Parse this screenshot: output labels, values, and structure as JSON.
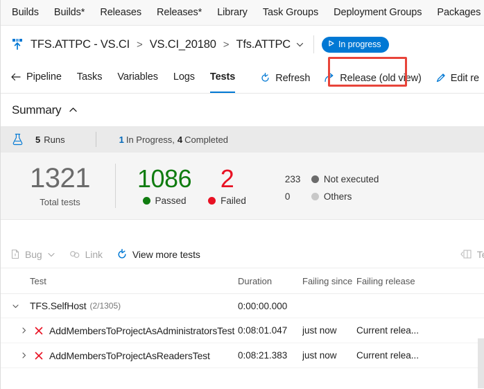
{
  "hub_nav": {
    "items": [
      {
        "label": "Builds"
      },
      {
        "label": "Builds*"
      },
      {
        "label": "Releases"
      },
      {
        "label": "Releases*"
      },
      {
        "label": "Library"
      },
      {
        "label": "Task Groups"
      },
      {
        "label": "Deployment Groups"
      },
      {
        "label": "Packages"
      }
    ]
  },
  "breadcrumb": {
    "icon": "release-pipeline-icon",
    "pipeline": "TFS.ATTPC - VS.CI",
    "separator": ">",
    "release": "VS.CI_20180",
    "stage": "Tfs.ATTPC",
    "stage_chevron_icon": "chevron-down-icon",
    "status": {
      "label": "In progress",
      "icon": "play-triangle-icon",
      "color": "#0078d4"
    },
    "highlight_color": "#e8443a"
  },
  "pivots": {
    "back_label": "Pipeline",
    "back_icon": "arrow-left-icon",
    "tabs": [
      {
        "label": "Tasks",
        "selected": false
      },
      {
        "label": "Variables",
        "selected": false
      },
      {
        "label": "Logs",
        "selected": false
      },
      {
        "label": "Tests",
        "selected": true
      }
    ],
    "selected_color": "#0078d4",
    "tools": [
      {
        "label": "Refresh",
        "icon": "refresh-icon"
      },
      {
        "label": "Release (old view)",
        "icon": "arrow-redo-icon"
      },
      {
        "label": "Edit re",
        "icon": "pencil-edit-icon"
      }
    ]
  },
  "summary": {
    "title": "Summary",
    "collapse_icon": "chevron-up-icon",
    "runs": {
      "flask_icon": "test-flask-icon",
      "count": "5",
      "label": "Runs",
      "in_progress_count": "1",
      "in_progress_label": "In Progress,",
      "completed_count": "4",
      "completed_label": "Completed"
    },
    "stats": {
      "total": {
        "value": "1321",
        "label": "Total tests",
        "color": "#6b6b6b"
      },
      "passed": {
        "value": "1086",
        "label": "Passed",
        "color": "#107c10"
      },
      "failed": {
        "value": "2",
        "label": "Failed",
        "color": "#e81123"
      },
      "not_executed": {
        "value": "233",
        "label": "Not executed",
        "color": "#6b6b6b"
      },
      "others": {
        "value": "0",
        "label": "Others",
        "color": "#c8c8c8"
      }
    }
  },
  "action_bar": {
    "bug": {
      "label": "Bug",
      "icon": "bug-file-icon",
      "caret_icon": "chevron-down-icon",
      "disabled": true
    },
    "link": {
      "label": "Link",
      "icon": "link-icon",
      "disabled": true
    },
    "view_more": {
      "label": "View more tests",
      "icon": "refresh-icon",
      "disabled": false
    },
    "right_action": {
      "label": "Test r",
      "icon": "panel-collapse-icon",
      "disabled": true
    }
  },
  "results_grid": {
    "columns": [
      {
        "key": "test",
        "label": "Test"
      },
      {
        "key": "duration",
        "label": "Duration"
      },
      {
        "key": "since",
        "label": "Failing since"
      },
      {
        "key": "release",
        "label": "Failing release"
      }
    ],
    "rows": [
      {
        "type": "group",
        "expander_icon": "chevron-down-icon",
        "name": "TFS.SelfHost",
        "count": "(2/1305)",
        "duration": "0:00:00.000",
        "since": "",
        "release": ""
      },
      {
        "type": "test",
        "expander_icon": "chevron-right-icon",
        "status_icon": "failed-x-icon",
        "name": "AddMembersToProjectAsAdministratorsTest",
        "duration": "0:08:01.047",
        "since": "just now",
        "release": "Current relea..."
      },
      {
        "type": "test",
        "expander_icon": "chevron-right-icon",
        "status_icon": "failed-x-icon",
        "name": "AddMembersToProjectAsReadersTest",
        "duration": "0:08:21.383",
        "since": "just now",
        "release": "Current relea..."
      }
    ]
  }
}
